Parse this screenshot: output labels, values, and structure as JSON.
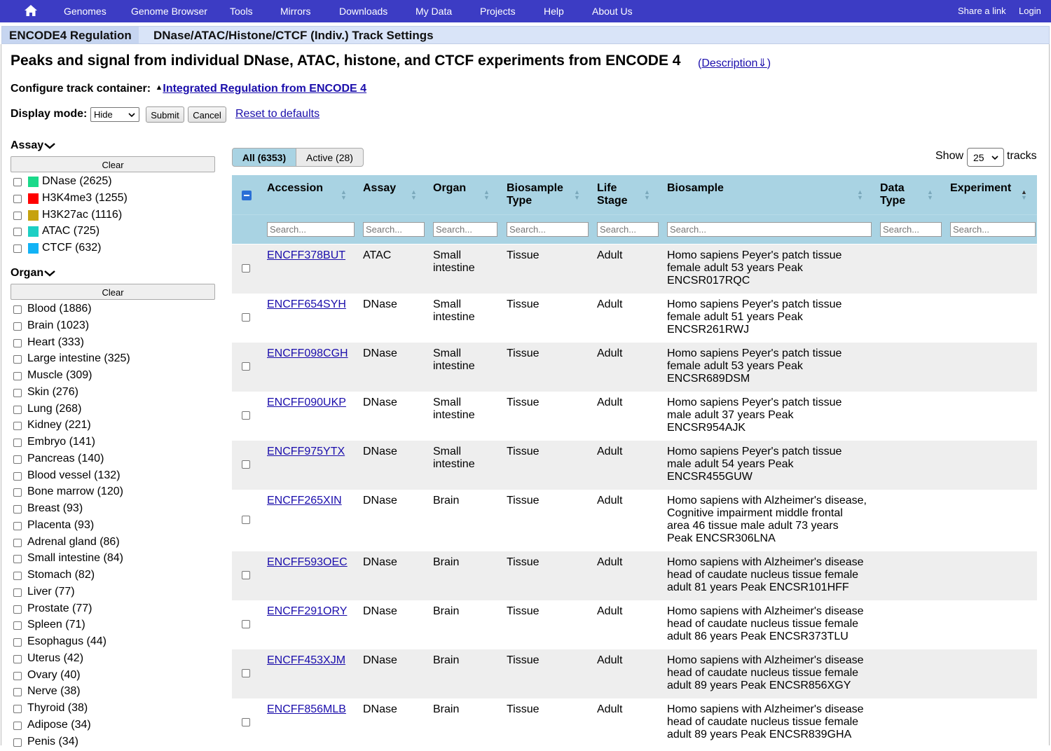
{
  "nav": {
    "items": [
      "Genomes",
      "Genome Browser",
      "Tools",
      "Mirrors",
      "Downloads",
      "My Data",
      "Projects",
      "Help",
      "About Us"
    ],
    "share": "Share a link",
    "login": "Login",
    "bg_color": "#3c3cc4"
  },
  "titlebar": {
    "tag": "ENCODE4 Regulation",
    "title": "DNase/ATAC/Histone/CTCF (Indiv.) Track Settings"
  },
  "heading": "Peaks and signal from individual DNase, ATAC, histone, and CTCF experiments from ENCODE 4",
  "description": {
    "open": "(",
    "link": "Description⇓",
    "close": ")"
  },
  "configure": {
    "label": "Configure track container:",
    "arrow": "▲",
    "link": "Integrated Regulation from ENCODE 4"
  },
  "display": {
    "label": "Display mode:",
    "mode": "Hide",
    "submit": "Submit",
    "cancel": "Cancel",
    "reset": "Reset to defaults"
  },
  "filters": {
    "assay": {
      "title": "Assay",
      "toggle": "❯",
      "clear": "Clear",
      "items": [
        {
          "label": "DNase (2625)",
          "color": "#1ad98a"
        },
        {
          "label": "H3K4me3 (1255)",
          "color": "#ff0000"
        },
        {
          "label": "H3K27ac (1116)",
          "color": "#c6a20f"
        },
        {
          "label": "ATAC (725)",
          "color": "#1dcfc4"
        },
        {
          "label": "CTCF (632)",
          "color": "#12b3f5"
        }
      ]
    },
    "organ": {
      "title": "Organ",
      "toggle": "❯",
      "clear": "Clear",
      "items": [
        "Blood (1886)",
        "Brain (1023)",
        "Heart (333)",
        "Large intestine (325)",
        "Muscle (309)",
        "Skin (276)",
        "Lung (268)",
        "Kidney (221)",
        "Embryo (141)",
        "Pancreas (140)",
        "Blood vessel (132)",
        "Bone marrow (120)",
        "Breast (93)",
        "Placenta (93)",
        "Adrenal gland (86)",
        "Small intestine (84)",
        "Stomach (82)",
        "Liver (77)",
        "Prostate (77)",
        "Spleen (71)",
        "Esophagus (44)",
        "Uterus (42)",
        "Ovary (40)",
        "Nerve (38)",
        "Thyroid (38)",
        "Adipose (34)",
        "Penis (34)"
      ]
    }
  },
  "tabs": {
    "all": "All (6353)",
    "active": "Active (28)"
  },
  "pager": {
    "show": "Show",
    "count": "25",
    "tracks": "tracks"
  },
  "table": {
    "columns": [
      "Accession",
      "Assay",
      "Organ",
      "Biosample Type",
      "Life Stage",
      "Biosample",
      "Data Type",
      "Experiment"
    ],
    "search_placeholder": "Search...",
    "rows": [
      {
        "accession": "ENCFF378BUT",
        "assay": "ATAC",
        "organ": "Small intestine",
        "btype": "Tissue",
        "stage": "Adult",
        "biosample": "Homo sapiens Peyer's patch tissue female adult 53 years Peak ENCSR017RQC"
      },
      {
        "accession": "ENCFF654SYH",
        "assay": "DNase",
        "organ": "Small intestine",
        "btype": "Tissue",
        "stage": "Adult",
        "biosample": "Homo sapiens Peyer's patch tissue female adult 51 years Peak ENCSR261RWJ"
      },
      {
        "accession": "ENCFF098CGH",
        "assay": "DNase",
        "organ": "Small intestine",
        "btype": "Tissue",
        "stage": "Adult",
        "biosample": "Homo sapiens Peyer's patch tissue female adult 53 years Peak ENCSR689DSM"
      },
      {
        "accession": "ENCFF090UKP",
        "assay": "DNase",
        "organ": "Small intestine",
        "btype": "Tissue",
        "stage": "Adult",
        "biosample": "Homo sapiens Peyer's patch tissue male adult 37 years Peak ENCSR954AJK"
      },
      {
        "accession": "ENCFF975YTX",
        "assay": "DNase",
        "organ": "Small intestine",
        "btype": "Tissue",
        "stage": "Adult",
        "biosample": "Homo sapiens Peyer's patch tissue male adult 54 years Peak ENCSR455GUW"
      },
      {
        "accession": "ENCFF265XIN",
        "assay": "DNase",
        "organ": "Brain",
        "btype": "Tissue",
        "stage": "Adult",
        "biosample": "Homo sapiens with Alzheimer's disease, Cognitive impairment middle frontal area 46 tissue male adult 73 years Peak ENCSR306LNA"
      },
      {
        "accession": "ENCFF593OEC",
        "assay": "DNase",
        "organ": "Brain",
        "btype": "Tissue",
        "stage": "Adult",
        "biosample": "Homo sapiens with Alzheimer's disease head of caudate nucleus tissue female adult 81 years Peak ENCSR101HFF"
      },
      {
        "accession": "ENCFF291ORY",
        "assay": "DNase",
        "organ": "Brain",
        "btype": "Tissue",
        "stage": "Adult",
        "biosample": "Homo sapiens with Alzheimer's disease head of caudate nucleus tissue female adult 86 years Peak ENCSR373TLU"
      },
      {
        "accession": "ENCFF453XJM",
        "assay": "DNase",
        "organ": "Brain",
        "btype": "Tissue",
        "stage": "Adult",
        "biosample": "Homo sapiens with Alzheimer's disease head of caudate nucleus tissue female adult 89 years Peak ENCSR856XGY"
      },
      {
        "accession": "ENCFF856MLB",
        "assay": "DNase",
        "organ": "Brain",
        "btype": "Tissue",
        "stage": "Adult",
        "biosample": "Homo sapiens with Alzheimer's disease head of caudate nucleus tissue female adult 89 years Peak ENCSR839GHA"
      }
    ]
  }
}
